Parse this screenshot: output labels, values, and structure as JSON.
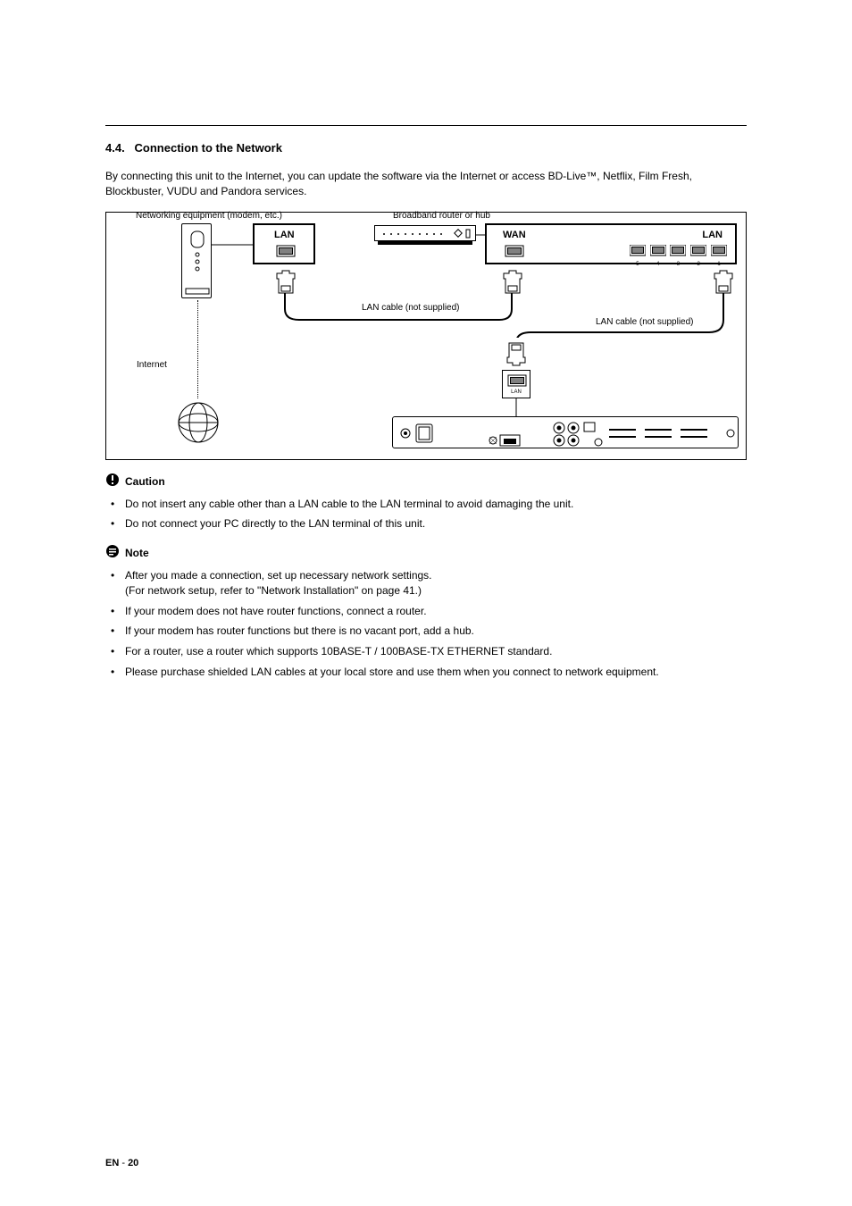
{
  "section": {
    "number": "4.4.",
    "title": "Connection to the Network"
  },
  "intro": "By connecting this unit to the Internet, you can update the software via the Internet or access BD-Live™, Netflix, Film Fresh, Blockbuster, VUDU and Pandora services.",
  "diagram": {
    "labels": {
      "modem_caption": "Networking equipment (modem, etc.)",
      "router_caption": "Broadband router or hub",
      "internet": "Internet",
      "lan_cable1": "LAN cable (not supplied)",
      "lan_cable2": "LAN cable (not supplied)",
      "lan": "LAN",
      "wan": "WAN",
      "lan2": "LAN",
      "rear_lan": "LAN"
    },
    "port_numbers": [
      "5",
      "4",
      "3",
      "2",
      "1"
    ]
  },
  "caution": {
    "heading": "Caution",
    "items": [
      "Do not insert any cable other than a LAN cable to the LAN terminal to avoid damaging the unit.",
      "Do not connect your PC directly to the LAN terminal of this unit."
    ]
  },
  "note": {
    "heading": "Note",
    "items": [
      "After you made a connection, set up necessary network settings.",
      "If your modem does not have router functions, connect a router.",
      "If your modem has router functions but there is no vacant port, add a hub.",
      "For a router, use a router which supports 10BASE-T / 100BASE-TX ETHERNET standard.",
      "Please purchase shielded LAN cables at your local store and use them when you connect to network equipment."
    ],
    "subline": "(For network setup, refer to \"Network Installation\" on page 41.)"
  },
  "footer": {
    "lang": "EN",
    "sep": " - ",
    "page": "20"
  }
}
